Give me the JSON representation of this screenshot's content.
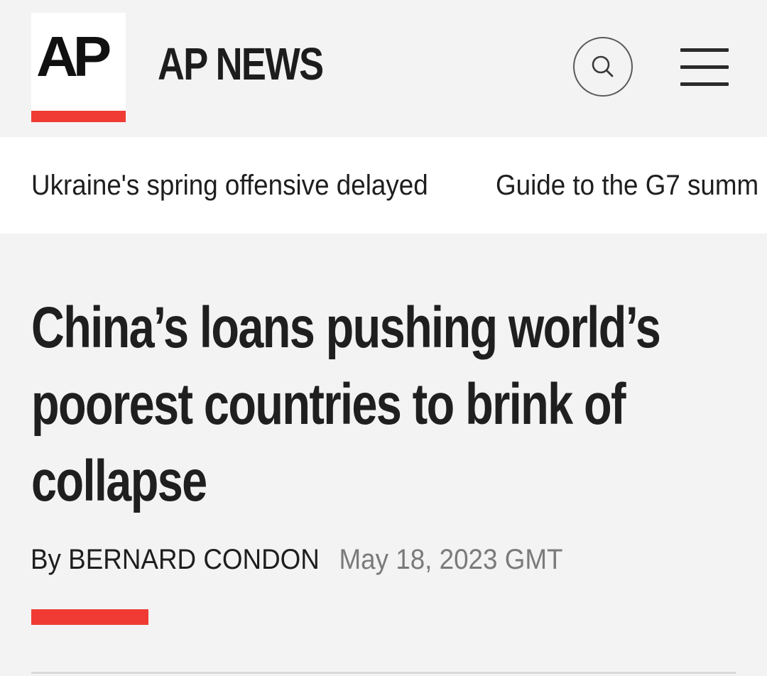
{
  "header": {
    "logo_text": "AP",
    "brand_name": "AP NEWS",
    "search_icon": "search-icon",
    "menu_icon": "hamburger-menu-icon"
  },
  "trending": {
    "items": [
      "Ukraine's spring offensive delayed",
      "Guide to the G7 summ"
    ]
  },
  "article": {
    "headline": "China’s loans pushing world’s poorest countries to brink of collapse",
    "byline": "By BERNARD CONDON",
    "date": "May 18, 2023 GMT"
  },
  "colors": {
    "accent": "#ef3b33",
    "background": "#f3f3f3",
    "text": "#1f1f1f",
    "muted": "#7a7a7a"
  }
}
